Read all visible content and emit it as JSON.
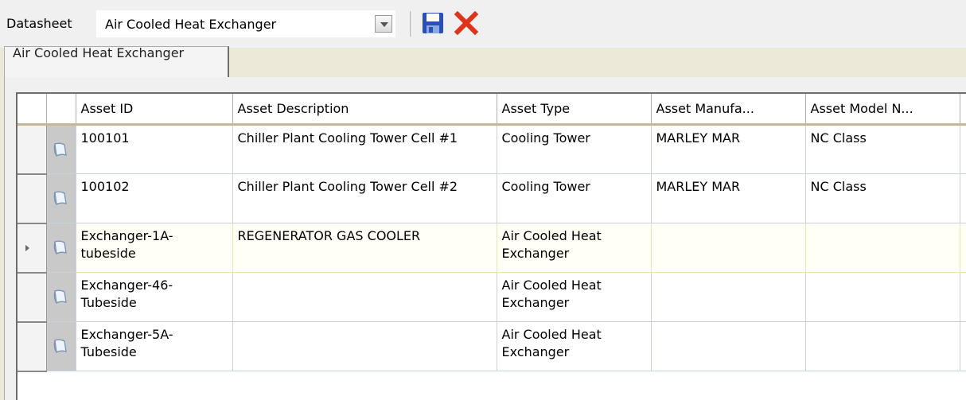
{
  "toolbar": {
    "datasheet_label": "Datasheet",
    "datasheet_value": "Air Cooled Heat Exchanger",
    "save_icon": "save-icon",
    "cancel_icon": "close-icon"
  },
  "tabs": [
    {
      "label": "Air Cooled Heat Exchanger",
      "active": true
    }
  ],
  "grid": {
    "columns": [
      "Asset ID",
      "Asset Description",
      "Asset Type",
      "Asset Manufa...",
      "Asset Model N..."
    ],
    "rows": [
      {
        "asset_id": "100101",
        "description": "Chiller Plant Cooling Tower Cell #1",
        "type": "Cooling Tower",
        "manufacturer": "MARLEY MAR",
        "model": "NC Class",
        "current": false
      },
      {
        "asset_id": "100102",
        "description": "Chiller Plant Cooling Tower Cell #2",
        "type": "Cooling Tower",
        "manufacturer": "MARLEY MAR",
        "model": "NC Class",
        "current": false
      },
      {
        "asset_id": "Exchanger-1A-tubeside",
        "description": "REGENERATOR GAS COOLER",
        "type": "Air Cooled Heat Exchanger",
        "manufacturer": "",
        "model": "",
        "current": true
      },
      {
        "asset_id": "Exchanger-46-Tubeside",
        "description": "",
        "type": "Air Cooled Heat Exchanger",
        "manufacturer": "",
        "model": "",
        "current": false
      },
      {
        "asset_id": "Exchanger-5A-Tubeside",
        "description": "",
        "type": "Air Cooled Heat Exchanger",
        "manufacturer": "",
        "model": "",
        "current": false
      }
    ]
  },
  "colors": {
    "save_icon_blue": "#2a4fb8",
    "cancel_icon_red": "#e0331b",
    "header_border": "#c7b79a"
  }
}
